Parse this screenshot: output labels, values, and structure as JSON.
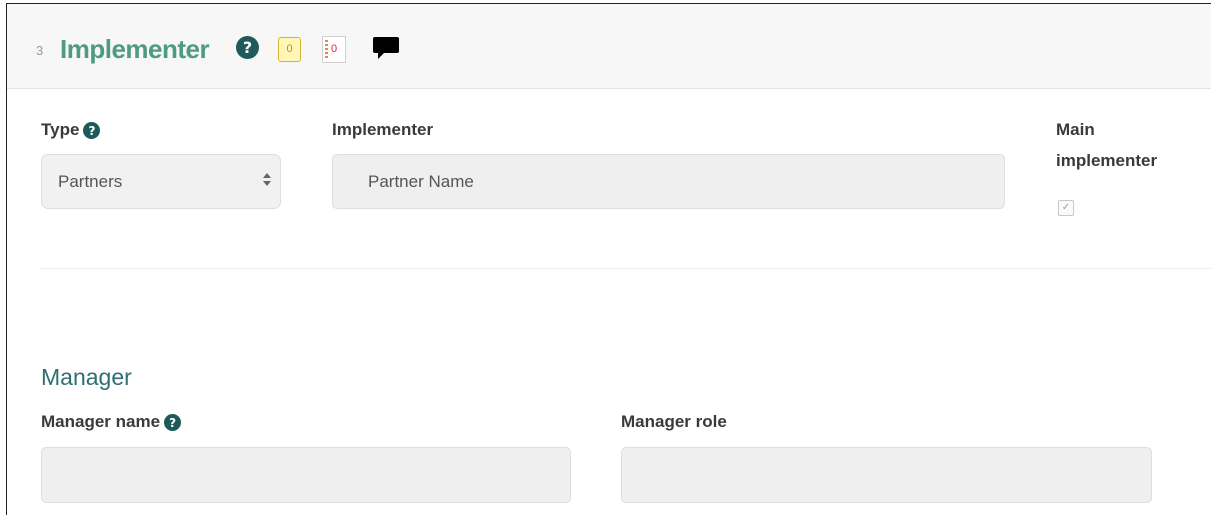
{
  "section": {
    "number": "3",
    "title": "Implementer",
    "help_glyph": "?",
    "badge_yellow_count": "0",
    "badge_red_count": "0",
    "comment_icon": "speech-bubble"
  },
  "fields": {
    "type_label": "Type",
    "type_value": "Partners",
    "implementer_label": "Implementer",
    "implementer_value": "Partner Name",
    "main_implementer_label_line1": "Main",
    "main_implementer_label_line2": "implementer",
    "main_implementer_checked": true,
    "check_glyph": "✓"
  },
  "manager": {
    "title": "Manager",
    "name_label": "Manager name",
    "name_value": "",
    "role_label": "Manager role",
    "role_value": ""
  },
  "colors": {
    "section_title": "#4e9a83",
    "help_icon": "#1f5a5a",
    "subsection_title": "#2e6e73",
    "field_bg": "#efefef"
  }
}
